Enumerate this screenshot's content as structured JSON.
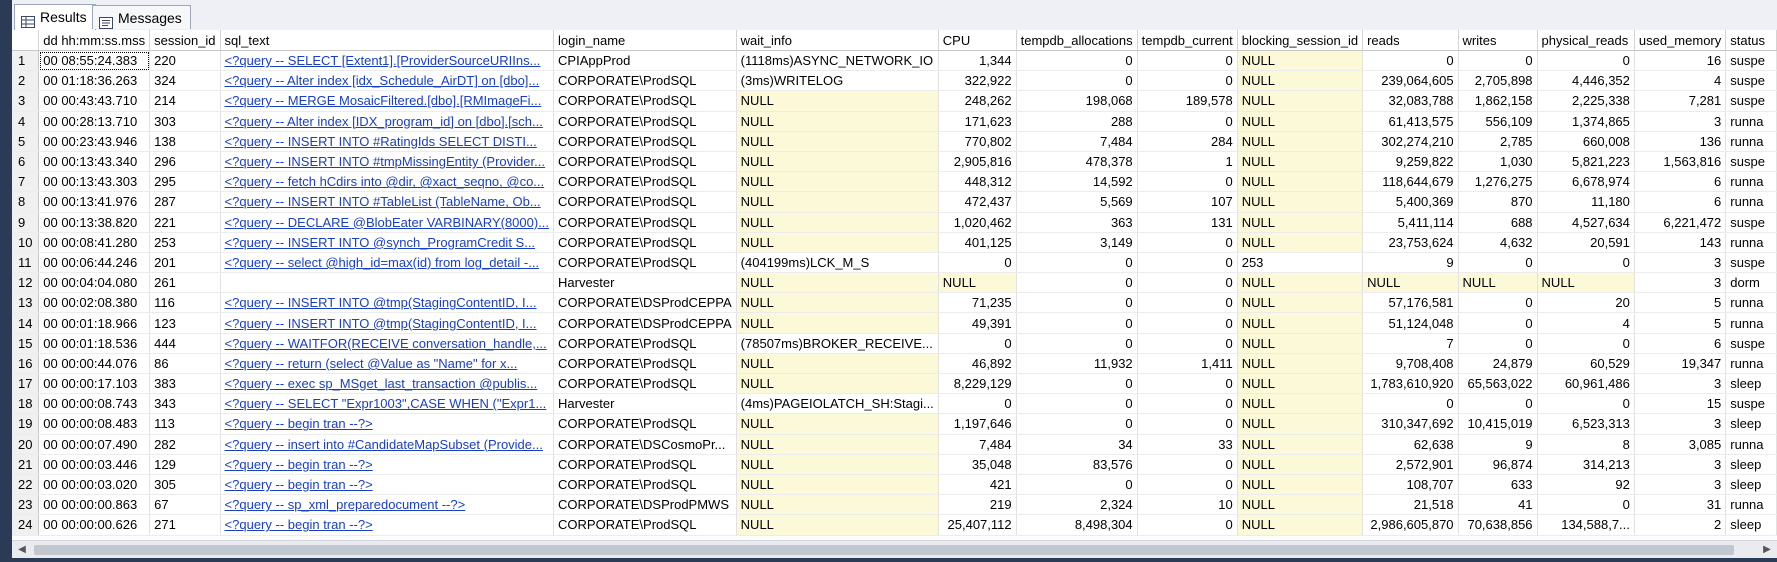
{
  "tabs": [
    {
      "label": "Results",
      "icon": "grid-icon",
      "active": true
    },
    {
      "label": "Messages",
      "icon": "messages-icon",
      "active": false
    }
  ],
  "columns": [
    "",
    "dd hh:mm:ss.mss",
    "session_id",
    "sql_text",
    "login_name",
    "wait_info",
    "CPU",
    "tempdb_allocations",
    "tempdb_current",
    "blocking_session_id",
    "reads",
    "writes",
    "physical_reads",
    "used_memory",
    "status"
  ],
  "rows": [
    [
      "1",
      "00 08:55:24.383",
      "220",
      "<?query --  SELECT   [Extent1].[ProviderSourceURIIns...",
      "CPIAppProd",
      "(1118ms)ASYNC_NETWORK_IO",
      "1,344",
      "0",
      "0",
      "NULL",
      "0",
      "0",
      "0",
      "16",
      "suspe"
    ],
    [
      "2",
      "00 01:18:36.263",
      "324",
      "<?query --  Alter index [idx_Schedule_AirDT] on [dbo]...",
      "CORPORATE\\ProdSQL",
      "(3ms)WRITELOG",
      "322,922",
      "0",
      "0",
      "NULL",
      "239,064,605",
      "2,705,898",
      "4,446,352",
      "4",
      "suspe"
    ],
    [
      "3",
      "00 00:43:43.710",
      "214",
      "<?query --  MERGE MosaicFiltered.[dbo].[RMImageFi...",
      "CORPORATE\\ProdSQL",
      "NULL",
      "248,262",
      "198,068",
      "189,578",
      "NULL",
      "32,083,788",
      "1,862,158",
      "2,225,338",
      "7,281",
      "suspe"
    ],
    [
      "4",
      "00 00:28:13.710",
      "303",
      "<?query --  Alter index [IDX_program_id] on [dbo].[sch...",
      "CORPORATE\\ProdSQL",
      "NULL",
      "171,623",
      "288",
      "0",
      "NULL",
      "61,413,575",
      "556,109",
      "1,374,865",
      "3",
      "runna"
    ],
    [
      "5",
      "00 00:23:43.946",
      "138",
      "<?query --  INSERT INTO #RatingIds    SELECT DISTI...",
      "CORPORATE\\ProdSQL",
      "NULL",
      "770,802",
      "7,484",
      "284",
      "NULL",
      "302,274,210",
      "2,785",
      "660,008",
      "136",
      "runna"
    ],
    [
      "6",
      "00 00:13:43.340",
      "296",
      "<?query --  INSERT INTO #tmpMissingEntity (Provider...",
      "CORPORATE\\ProdSQL",
      "NULL",
      "2,905,816",
      "478,378",
      "1",
      "NULL",
      "9,259,822",
      "1,030",
      "5,821,223",
      "1,563,816",
      "suspe"
    ],
    [
      "7",
      "00 00:13:43.303",
      "295",
      "<?query --  fetch hCdirs into @dir, @xact_seqno, @co...",
      "CORPORATE\\ProdSQL",
      "NULL",
      "448,312",
      "14,592",
      "0",
      "NULL",
      "118,644,679",
      "1,276,275",
      "6,678,974",
      "6",
      "runna"
    ],
    [
      "8",
      "00 00:13:41.976",
      "287",
      "<?query --  INSERT INTO #TableList (TableName, Ob...",
      "CORPORATE\\ProdSQL",
      "NULL",
      "472,437",
      "5,569",
      "107",
      "NULL",
      "5,400,369",
      "870",
      "11,180",
      "6",
      "runna"
    ],
    [
      "9",
      "00 00:13:38.820",
      "221",
      "<?query --  DECLARE @BlobEater VARBINARY(8000)...",
      "CORPORATE\\ProdSQL",
      "NULL",
      "1,020,462",
      "363",
      "131",
      "NULL",
      "5,411,114",
      "688",
      "4,527,634",
      "6,221,472",
      "suspe"
    ],
    [
      "10",
      "00 00:08:41.280",
      "253",
      "<?query --  INSERT INTO @synch_ProgramCredit    S...",
      "CORPORATE\\ProdSQL",
      "NULL",
      "401,125",
      "3,149",
      "0",
      "NULL",
      "23,753,624",
      "4,632",
      "20,591",
      "143",
      "runna"
    ],
    [
      "11",
      "00 00:06:44.246",
      "201",
      "<?query --  select @high_id=max(id) from log_detail -...",
      "CORPORATE\\ProdSQL",
      "(404199ms)LCK_M_S",
      "0",
      "0",
      "0",
      "253",
      "9",
      "0",
      "0",
      "3",
      "suspe"
    ],
    [
      "12",
      "00 00:04:04.080",
      "261",
      "",
      "Harvester",
      "NULL",
      "NULL",
      "0",
      "0",
      "NULL",
      "NULL",
      "NULL",
      "NULL",
      "3",
      "dorm"
    ],
    [
      "13",
      "00 00:02:08.380",
      "116",
      "<?query --  INSERT INTO @tmp(StagingContentID, I...",
      "CORPORATE\\DSProdCEPPA",
      "NULL",
      "71,235",
      "0",
      "0",
      "NULL",
      "57,176,581",
      "0",
      "20",
      "5",
      "runna"
    ],
    [
      "14",
      "00 00:01:18.966",
      "123",
      "<?query --  INSERT INTO @tmp(StagingContentID, I...",
      "CORPORATE\\DSProdCEPPA",
      "NULL",
      "49,391",
      "0",
      "0",
      "NULL",
      "51,124,048",
      "0",
      "4",
      "5",
      "runna"
    ],
    [
      "15",
      "00 00:01:18.536",
      "444",
      "<?query --  WAITFOR(RECEIVE conversation_handle,...",
      "CORPORATE\\ProdSQL",
      "(78507ms)BROKER_RECEIVE...",
      "0",
      "0",
      "0",
      "NULL",
      "7",
      "0",
      "0",
      "6",
      "suspe"
    ],
    [
      "16",
      "00 00:00:44.076",
      "86",
      "<?query --  return   (select @Value as \"Name\"   for x...",
      "CORPORATE\\ProdSQL",
      "NULL",
      "46,892",
      "11,932",
      "1,411",
      "NULL",
      "9,708,408",
      "24,879",
      "60,529",
      "19,347",
      "runna"
    ],
    [
      "17",
      "00 00:00:17.103",
      "383",
      "<?query --  exec sp_MSget_last_transaction @publis...",
      "CORPORATE\\ProdSQL",
      "NULL",
      "8,229,129",
      "0",
      "0",
      "NULL",
      "1,783,610,920",
      "65,563,022",
      "60,961,486",
      "3",
      "sleep"
    ],
    [
      "18",
      "00 00:00:08.743",
      "343",
      "<?query --  SELECT \"Expr1003\",CASE WHEN (\"Expr1...",
      "Harvester",
      "(4ms)PAGEIOLATCH_SH:Stagi...",
      "0",
      "0",
      "0",
      "NULL",
      "0",
      "0",
      "0",
      "15",
      "suspe"
    ],
    [
      "19",
      "00 00:00:08.483",
      "113",
      "<?query --  begin tran  --?>",
      "CORPORATE\\ProdSQL",
      "NULL",
      "1,197,646",
      "0",
      "0",
      "NULL",
      "310,347,692",
      "10,415,019",
      "6,523,313",
      "3",
      "sleep"
    ],
    [
      "20",
      "00 00:00:07.490",
      "282",
      "<?query --  insert into #CandidateMapSubset (Provide...",
      "CORPORATE\\DSCosmoPr...",
      "NULL",
      "7,484",
      "34",
      "33",
      "NULL",
      "62,638",
      "9",
      "8",
      "3,085",
      "runna"
    ],
    [
      "21",
      "00 00:00:03.446",
      "129",
      "<?query --  begin tran  --?>",
      "CORPORATE\\ProdSQL",
      "NULL",
      "35,048",
      "83,576",
      "0",
      "NULL",
      "2,572,901",
      "96,874",
      "314,213",
      "3",
      "sleep"
    ],
    [
      "22",
      "00 00:00:03.020",
      "305",
      "<?query --  begin tran  --?>",
      "CORPORATE\\ProdSQL",
      "NULL",
      "421",
      "0",
      "0",
      "NULL",
      "108,707",
      "633",
      "92",
      "3",
      "sleep"
    ],
    [
      "23",
      "00 00:00:00.863",
      "67",
      "<?query --  sp_xml_preparedocument  --?>",
      "CORPORATE\\DSProdPMWS",
      "NULL",
      "219",
      "2,324",
      "10",
      "NULL",
      "21,518",
      "41",
      "0",
      "31",
      "runna"
    ],
    [
      "24",
      "00 00:00:00.626",
      "271",
      "<?query --  begin tran  --?>",
      "CORPORATE\\ProdSQL",
      "NULL",
      "25,407,112",
      "8,498,304",
      "0",
      "NULL",
      "2,986,605,870",
      "70,638,856",
      "134,588,7...",
      "2",
      "sleep"
    ]
  ],
  "scrollbar": {
    "left_arrow": "◀",
    "right_arrow": "▶"
  }
}
